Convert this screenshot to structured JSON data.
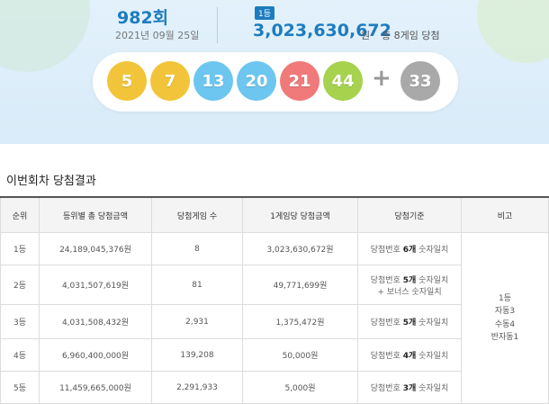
{
  "draw": {
    "round_number": "982",
    "round_suffix": "회",
    "date": "2021년 09월 25일",
    "rank_badge": "1등",
    "first_prize": "3,023,630,672",
    "prize_unit": "원",
    "winners_text": "총 8게임 당첨"
  },
  "balls": [
    {
      "num": "5",
      "color": "#f2c43a"
    },
    {
      "num": "7",
      "color": "#f2c43a"
    },
    {
      "num": "13",
      "color": "#6cc6ef"
    },
    {
      "num": "20",
      "color": "#6cc6ef"
    },
    {
      "num": "21",
      "color": "#f07a7a"
    },
    {
      "num": "44",
      "color": "#a6d24e"
    }
  ],
  "plus_sign": "+",
  "bonus": {
    "num": "33",
    "color": "#a9a9a9"
  },
  "results": {
    "title": "이번회차 당첨결과",
    "headers": [
      "순위",
      "등위별 총 당첨금액",
      "당첨게임 수",
      "1게임당 당첨금액",
      "당첨기준",
      "비고"
    ],
    "rows": [
      {
        "rank": "1등",
        "total": "24,189,045,376원",
        "games": "8",
        "per_game": "3,023,630,672원",
        "crit_pre": "당첨번호 ",
        "crit_bold": "6개",
        "crit_post": " 숫자일치",
        "crit_line2": ""
      },
      {
        "rank": "2등",
        "total": "4,031,507,619원",
        "games": "81",
        "per_game": "49,771,699원",
        "crit_pre": "당첨번호 ",
        "crit_bold": "5개",
        "crit_post": " 숫자일치",
        "crit_line2": "+ 보너스 숫자일치"
      },
      {
        "rank": "3등",
        "total": "4,031,508,432원",
        "games": "2,931",
        "per_game": "1,375,472원",
        "crit_pre": "당첨번호 ",
        "crit_bold": "5개",
        "crit_post": " 숫자일치",
        "crit_line2": ""
      },
      {
        "rank": "4등",
        "total": "6,960,400,000원",
        "games": "139,208",
        "per_game": "50,000원",
        "crit_pre": "당첨번호 ",
        "crit_bold": "4개",
        "crit_post": " 숫자일치",
        "crit_line2": ""
      },
      {
        "rank": "5등",
        "total": "11,459,665,000원",
        "games": "2,291,933",
        "per_game": "5,000원",
        "crit_pre": "당첨번호 ",
        "crit_bold": "3개",
        "crit_post": " 숫자일치",
        "crit_line2": ""
      }
    ],
    "note_lines": [
      "1등",
      "자동3",
      "수동4",
      "반자동1"
    ]
  }
}
